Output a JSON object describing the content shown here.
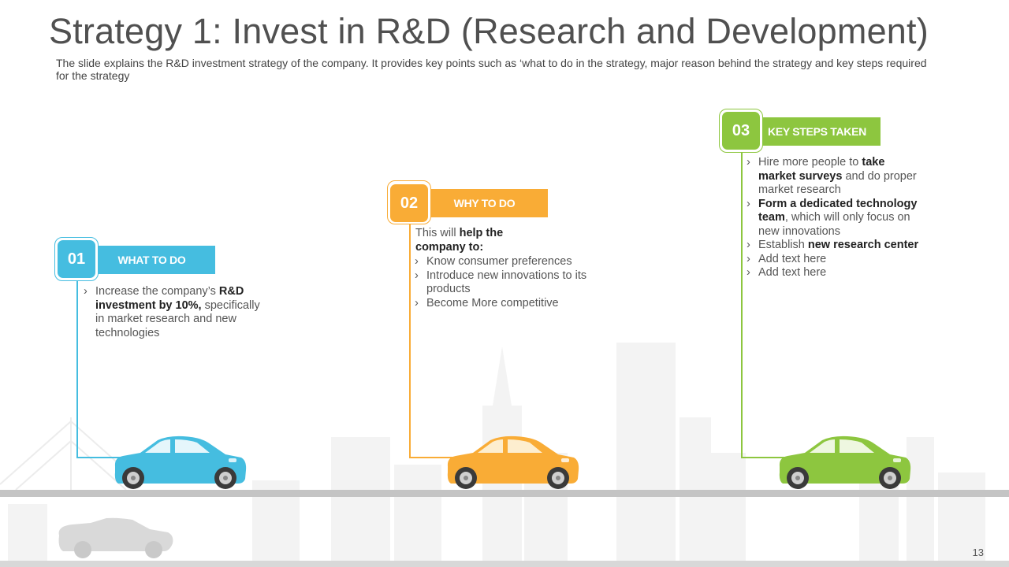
{
  "slide": {
    "title": "Strategy 1: Invest in R&D (Research and Development)",
    "subtitle": "The slide explains the R&D investment strategy of the company. It provides key points such as ‘what to do in the strategy, major reason behind the strategy and key steps required for the strategy",
    "page_number": "13"
  },
  "colors": {
    "blue": "#45bde0",
    "orange": "#f9ac36",
    "green": "#8dc63f"
  },
  "steps": [
    {
      "number": "01",
      "heading": "WHAT TO DO",
      "items": [
        {
          "pre": "Increase the company’s ",
          "bold": "R&D investment by 10%,",
          "post": " specifically in market research and new technologies"
        }
      ]
    },
    {
      "number": "02",
      "heading": "WHY TO DO",
      "intro": {
        "pre": "This will ",
        "bold": "help the company to:"
      },
      "items": [
        {
          "pre": "Know consumer preferences",
          "bold": "",
          "post": ""
        },
        {
          "pre": "Introduce new innovations to its products",
          "bold": "",
          "post": ""
        },
        {
          "pre": "Become More competitive",
          "bold": "",
          "post": ""
        }
      ]
    },
    {
      "number": "03",
      "heading": "KEY STEPS TAKEN",
      "items": [
        {
          "pre": "Hire more people to ",
          "bold": "take market surveys",
          "post": " and do proper market research"
        },
        {
          "pre": "",
          "bold": "Form a dedicated technology team",
          "post": ", which will only focus on new innovations"
        },
        {
          "pre": "Establish ",
          "bold": "new research center",
          "post": ""
        },
        {
          "pre": "Add text here",
          "bold": "",
          "post": ""
        },
        {
          "pre": "Add text here",
          "bold": "",
          "post": ""
        }
      ]
    }
  ]
}
